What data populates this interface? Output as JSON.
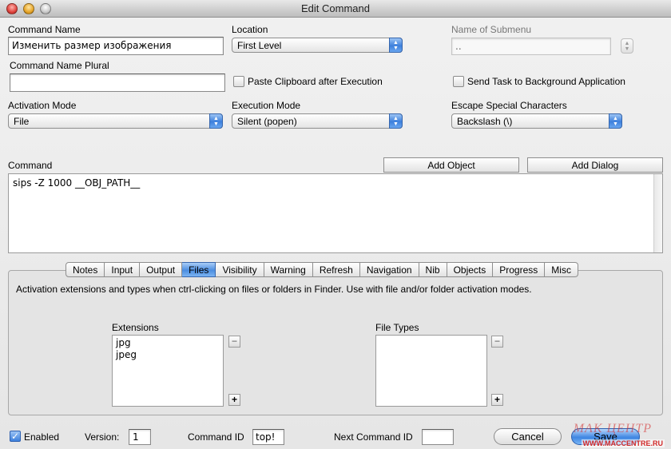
{
  "window": {
    "title": "Edit Command"
  },
  "fields": {
    "command_name_label": "Command Name",
    "command_name_value": "Изменить размер изображения",
    "location_label": "Location",
    "location_value": "First Level",
    "submenu_label": "Name of Submenu",
    "submenu_value": "..",
    "command_name_plural_label": "Command Name Plural",
    "command_name_plural_value": "",
    "paste_clipboard_label": "Paste Clipboard after Execution",
    "send_task_label": "Send Task to Background Application",
    "activation_mode_label": "Activation Mode",
    "activation_mode_value": "File",
    "execution_mode_label": "Execution Mode",
    "execution_mode_value": "Silent (popen)",
    "escape_label": "Escape Special Characters",
    "escape_value": "Backslash (\\)"
  },
  "command": {
    "label": "Command",
    "add_object": "Add Object",
    "add_dialog": "Add Dialog",
    "text": "sips -Z 1000 __OBJ_PATH__"
  },
  "tabs": [
    {
      "label": "Notes"
    },
    {
      "label": "Input"
    },
    {
      "label": "Output"
    },
    {
      "label": "Files"
    },
    {
      "label": "Visibility"
    },
    {
      "label": "Warning"
    },
    {
      "label": "Refresh"
    },
    {
      "label": "Navigation"
    },
    {
      "label": "Nib"
    },
    {
      "label": "Objects"
    },
    {
      "label": "Progress"
    },
    {
      "label": "Misc"
    }
  ],
  "selected_tab": "Files",
  "files_tab": {
    "description": "Activation extensions and types when ctrl-clicking on files or folders in Finder. Use with file and/or folder activation modes.",
    "extensions_label": "Extensions",
    "extensions": [
      "jpg",
      "jpeg"
    ],
    "file_types_label": "File Types",
    "file_types": []
  },
  "bottom": {
    "enabled_label": "Enabled",
    "version_label": "Version:",
    "version_value": "1",
    "command_id_label": "Command ID",
    "command_id_value": "top!",
    "next_command_id_label": "Next Command ID",
    "next_command_id_value": "",
    "cancel": "Cancel",
    "save": "Save"
  },
  "watermark": {
    "text": "МАК ЦЕНТР",
    "url": "WWW.MACCENTRE.RU"
  },
  "colors": {
    "accent": "#3d80dc",
    "watermark_red": "#d22a2a"
  }
}
